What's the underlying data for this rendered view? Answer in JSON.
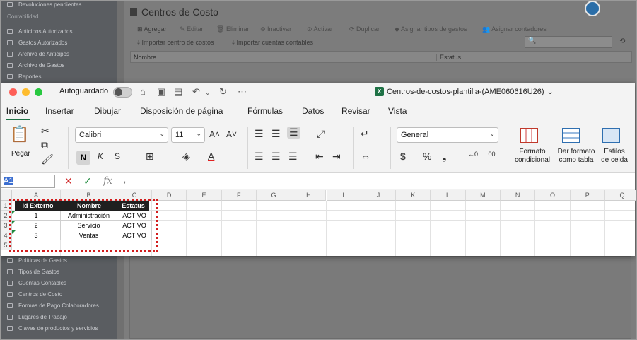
{
  "web_app": {
    "sidebar_top": [
      {
        "label": "Devoluciones pendientes"
      }
    ],
    "section_accounting": "Contabilidad",
    "sidebar_mid": [
      {
        "label": "Anticipos Autorizados"
      },
      {
        "label": "Gastos Autorizados"
      },
      {
        "label": "Archivo de Anticipos"
      },
      {
        "label": "Archivo de Gastos"
      },
      {
        "label": "Reportes"
      }
    ],
    "sidebar_bottom": [
      {
        "label": "Políticas de Gastos"
      },
      {
        "label": "Tipos de Gastos"
      },
      {
        "label": "Cuentas Contables"
      },
      {
        "label": "Centros de Costo"
      },
      {
        "label": "Formas de Pago Colaboradores"
      },
      {
        "label": "Lugares de Trabajo"
      },
      {
        "label": "Claves de productos y servicios"
      }
    ],
    "page_title": "Centros de Costo",
    "toolbar": {
      "add": "Agregar",
      "edit": "Editar",
      "delete": "Eliminar",
      "deactivate": "Inactivar",
      "activate": "Activar",
      "duplicate": "Duplicar",
      "assign_expense_types": "Asignar tipos de gastos",
      "assign_accountants": "Asignar contadores",
      "import_cost_center": "Importar centro de costos",
      "import_accounts": "Importar cuentas contables"
    },
    "table_headers": {
      "name": "Nombre",
      "status": "Estatus"
    }
  },
  "excel": {
    "autosave_label": "Autoguardado",
    "doc_title": "Centros-de-costos-plantilla-(AME060616U26)",
    "tabs": [
      "Inicio",
      "Insertar",
      "Dibujar",
      "Disposición de página",
      "Fórmulas",
      "Datos",
      "Revisar",
      "Vista"
    ],
    "active_tab": "Inicio",
    "ribbon": {
      "paste": "Pegar",
      "font_name": "Calibri",
      "font_size": "11",
      "bold": "N",
      "italic": "K",
      "underline": "S",
      "number_format": "General",
      "conditional_format": [
        "Formato",
        "condicional"
      ],
      "format_as_table": [
        "Dar formato",
        "como tabla"
      ],
      "cell_styles": [
        "Estilos",
        "de celda"
      ]
    },
    "name_box": "A1",
    "formula_content": ",",
    "columns": [
      "A",
      "B",
      "C",
      "D",
      "E",
      "F",
      "G",
      "H",
      "I",
      "J",
      "K",
      "L",
      "M",
      "N",
      "O",
      "P",
      "Q"
    ],
    "rows": [
      "1",
      "2",
      "3",
      "4",
      "5"
    ],
    "table": {
      "headers": [
        "Id Externo",
        "Nombre",
        "Estatus"
      ],
      "rows": [
        [
          "1",
          "Administración",
          "ACTIVO"
        ],
        [
          "2",
          "Servicio",
          "ACTIVO"
        ],
        [
          "3",
          "Ventas",
          "ACTIVO"
        ]
      ]
    },
    "colors": {
      "brand_green": "#1e7145",
      "highlight_dashed": "#d31d1d"
    }
  }
}
